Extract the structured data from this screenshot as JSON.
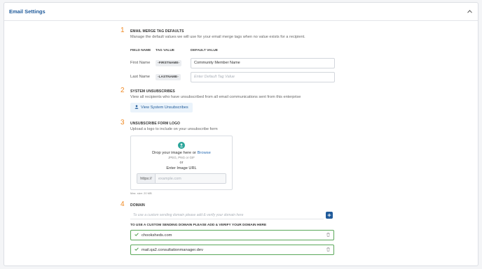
{
  "header": {
    "title": "Email Settings"
  },
  "merge": {
    "number": "1",
    "title": "EMAIL MERGE TAG DEFAULTS",
    "description": "Manage the default values we will use for your email merge tags when no value exists for a recipient.",
    "col_field": "FIELD NAME",
    "col_tag": "TAG VALUE",
    "col_default": "DEFAULT VALUE",
    "rows": [
      {
        "label": "First Name",
        "tag": "-FIRSTNAME-",
        "value": "Community Member Name",
        "placeholder": ""
      },
      {
        "label": "Last Name",
        "tag": "-LASTNAME-",
        "value": "",
        "placeholder": "Enter Default Tag Value"
      }
    ]
  },
  "unsub": {
    "number": "2",
    "title": "SYSTEM UNSUBSCRIBES",
    "description": "View all recipients who have unsubscribed from all email communications sent from this enterprise",
    "button": "View System Unsubscribes"
  },
  "logo": {
    "number": "3",
    "title": "UNSUBSCRIBE FORM LOGO",
    "description": "Upload a logo to include on your unsubscribe form",
    "drop_text": "Drop your image here or",
    "browse": "Browse",
    "formats": "JPEG, PNG or GIF",
    "or": "or",
    "url_label": "Enter Image URL",
    "url_prefix": "https://",
    "url_placeholder": "example.com",
    "max_size": "Max. size: 20 MB"
  },
  "domain": {
    "number": "4",
    "title": "DOMAIN",
    "placeholder": "To use a custom sending domain please add & verify your domain here",
    "note": "TO USE A CUSTOM SENDING DOMAIN PLEASE ADD & VERIFY YOUR DOMAIN HERE",
    "items": [
      "chooksheds.com",
      "mail.qa2.consultationmanager.dev"
    ]
  },
  "colors": {
    "accent": "#1f5a9a",
    "number": "#f08a24",
    "verified": "#5ba85a"
  }
}
